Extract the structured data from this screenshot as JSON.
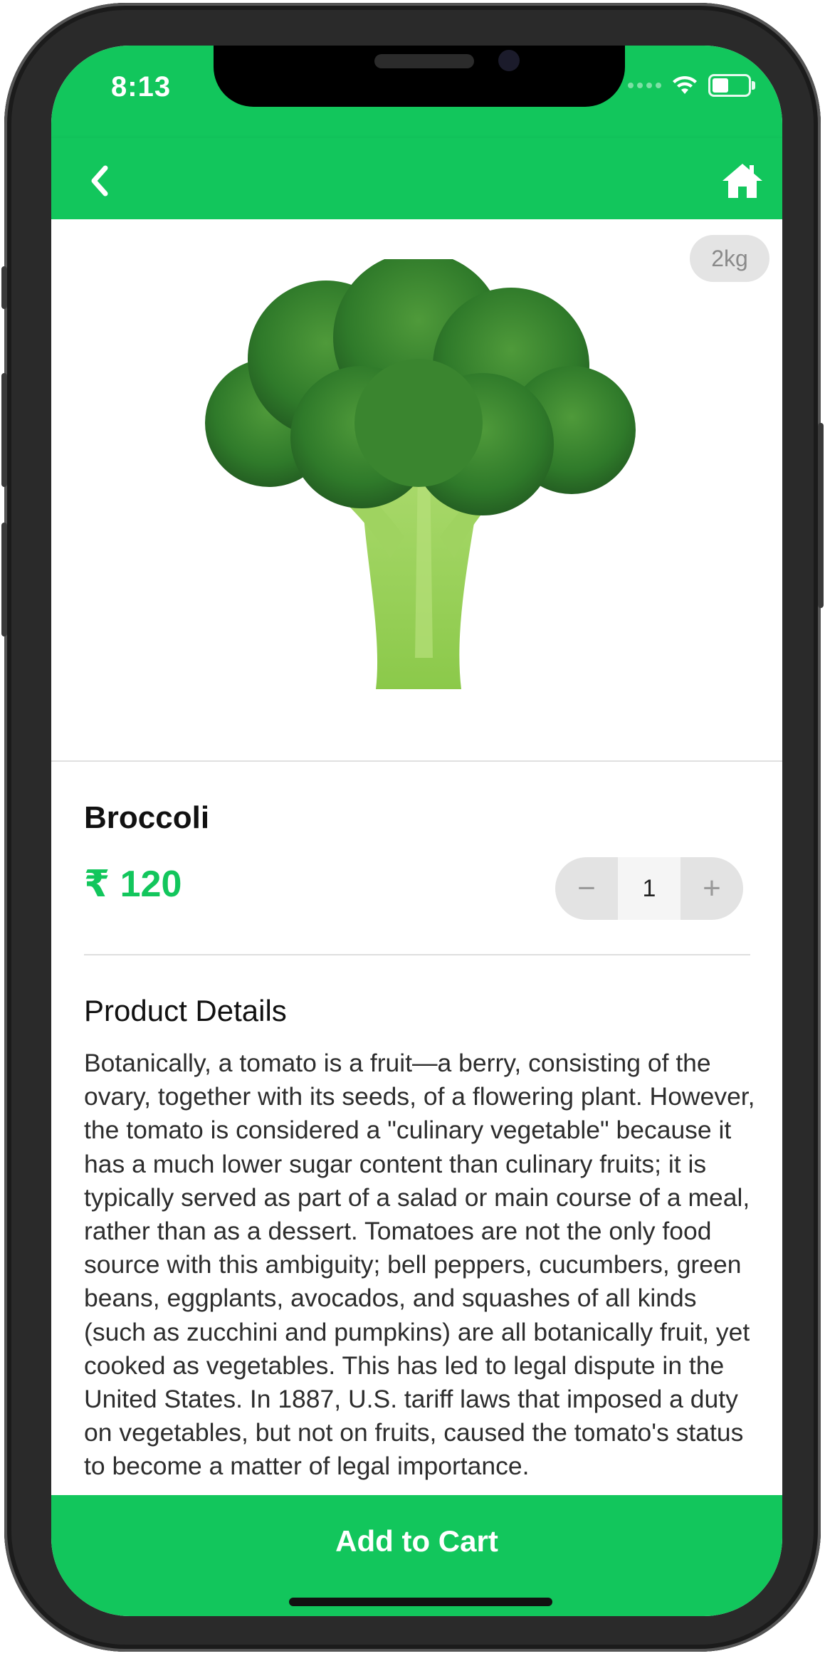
{
  "status_bar": {
    "time": "8:13"
  },
  "app_bar": {
    "back_icon": "chevron-left-icon",
    "home_icon": "home-icon"
  },
  "product": {
    "name": "Broccoli",
    "price": "₹ 120",
    "weight_badge": "2kg",
    "image_icon": "broccoli-image"
  },
  "quantity": {
    "minus": "−",
    "value": "1",
    "plus": "+"
  },
  "details": {
    "title": "Product Details",
    "text": "Botanically, a tomato is a fruit—a berry, consisting of the ovary, together with its seeds, of a flowering plant. However, the tomato is considered a \"culinary vegetable\" because it has a much lower sugar content than culinary fruits; it is typically served as part of a salad or main course of a meal, rather than as a dessert. Tomatoes are not the only food source with this ambiguity; bell peppers, cucumbers, green beans, eggplants, avocados, and squashes of all kinds (such as zucchini and pumpkins) are all botanically fruit, yet cooked as vegetables. This has led to legal dispute in the United States. In 1887, U.S. tariff laws that imposed a duty on vegetables, but not on fruits, caused the tomato's status to become a matter of legal importance."
  },
  "cart": {
    "label": "Add to Cart"
  },
  "colors": {
    "accent": "#12c65c",
    "badge_bg": "#e4e4e4",
    "stepper_bg": "#e3e3e3"
  }
}
